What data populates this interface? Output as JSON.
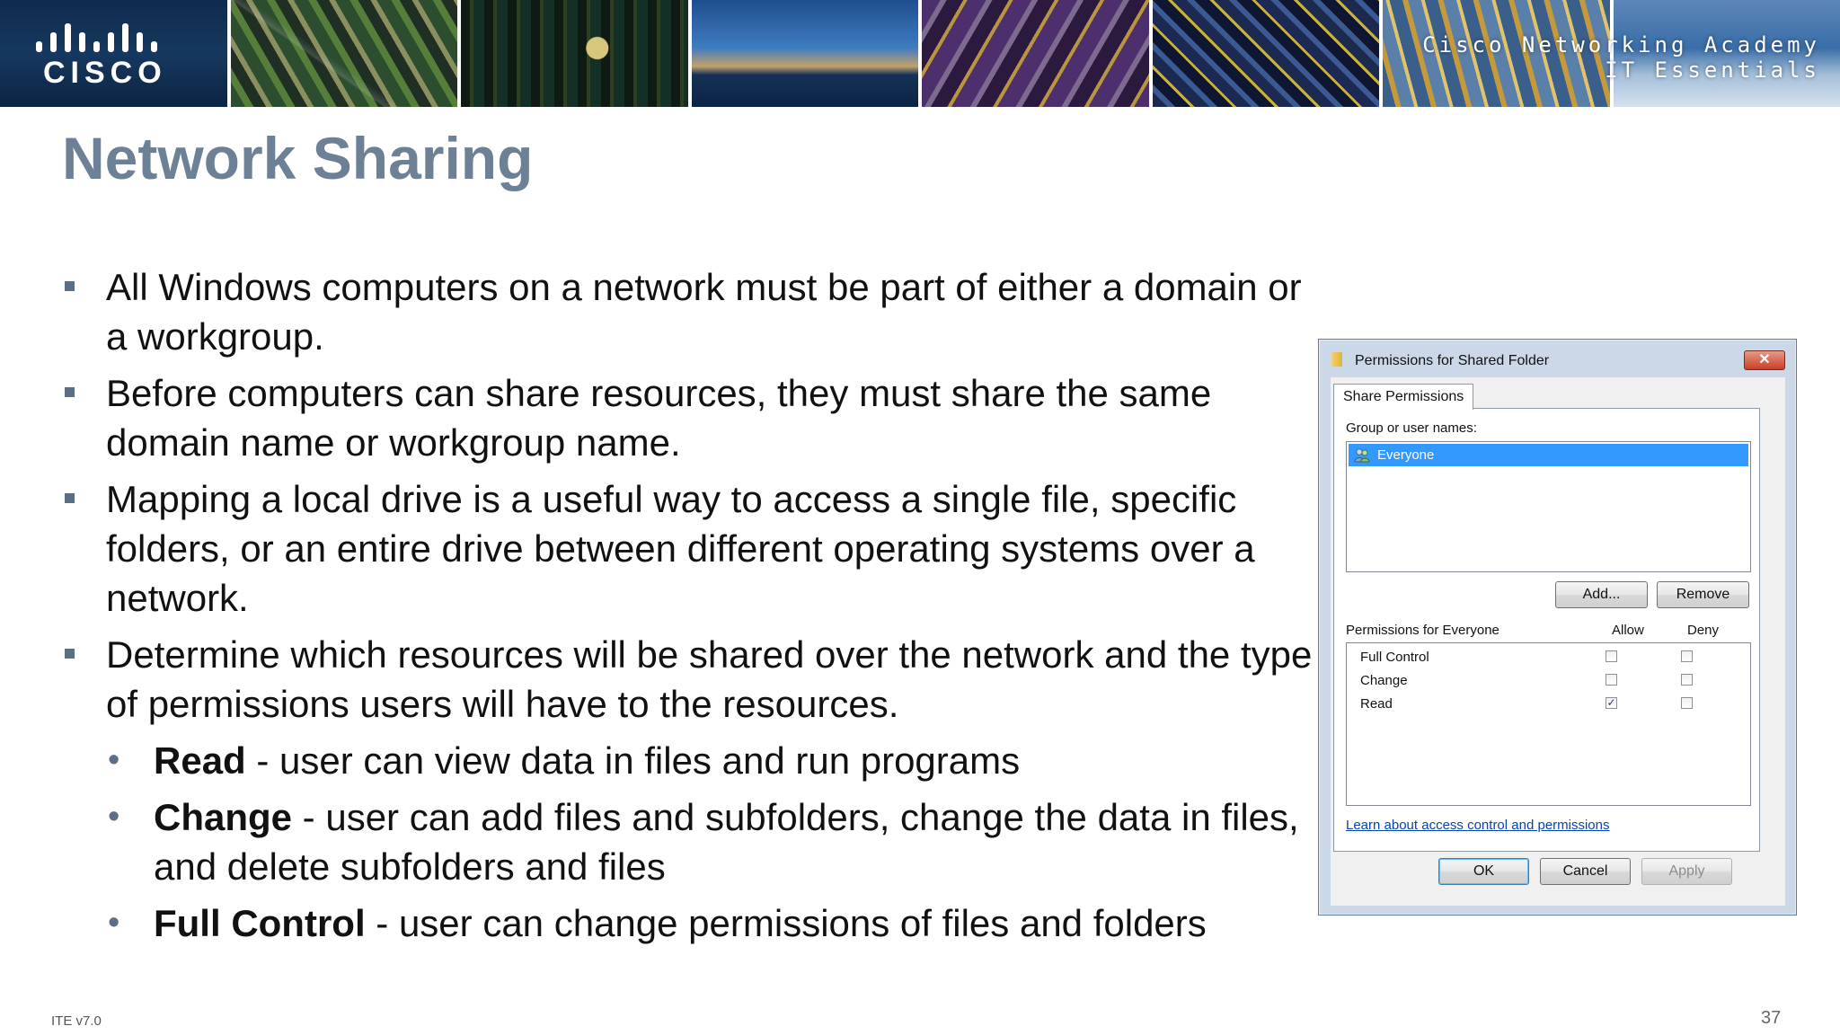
{
  "banner": {
    "logo_text": "CISCO",
    "line1": "Cisco Networking Academy",
    "line2": "IT Essentials"
  },
  "slide": {
    "title": "Network Sharing",
    "bullets": [
      "All Windows computers on a network must be part of either a domain or a workgroup.",
      "Before computers can share resources, they must share the same domain name or workgroup name.",
      "Mapping a local drive is a useful way to access a single file, specific folders, or an entire drive between different operating systems over a network.",
      "Determine which resources will be shared over the network and the type of permissions users will have to the resources."
    ],
    "sub_bullets": [
      {
        "term": "Read",
        "desc": " - user can view data in files and run programs"
      },
      {
        "term": "Change",
        "desc": " - user can add files and subfolders, change the data in files, and delete subfolders and files"
      },
      {
        "term": "Full Control",
        "desc": " - user can change permissions of files and folders"
      }
    ]
  },
  "footer": {
    "version": "ITE v7.0",
    "page": "37"
  },
  "dialog": {
    "title": "Permissions for Shared Folder",
    "close_symbol": "✕",
    "tab": "Share Permissions",
    "group_label": "Group or user names:",
    "users": [
      "Everyone"
    ],
    "add_label": "Add...",
    "remove_label": "Remove",
    "perm_label": "Permissions for Everyone",
    "allow_label": "Allow",
    "deny_label": "Deny",
    "permissions": [
      {
        "name": "Full Control",
        "allow": "",
        "deny": ""
      },
      {
        "name": "Change",
        "allow": "",
        "deny": ""
      },
      {
        "name": "Read",
        "allow": "✓",
        "deny": ""
      }
    ],
    "link": "Learn about access control and permissions",
    "ok_label": "OK",
    "cancel_label": "Cancel",
    "apply_label": "Apply"
  }
}
